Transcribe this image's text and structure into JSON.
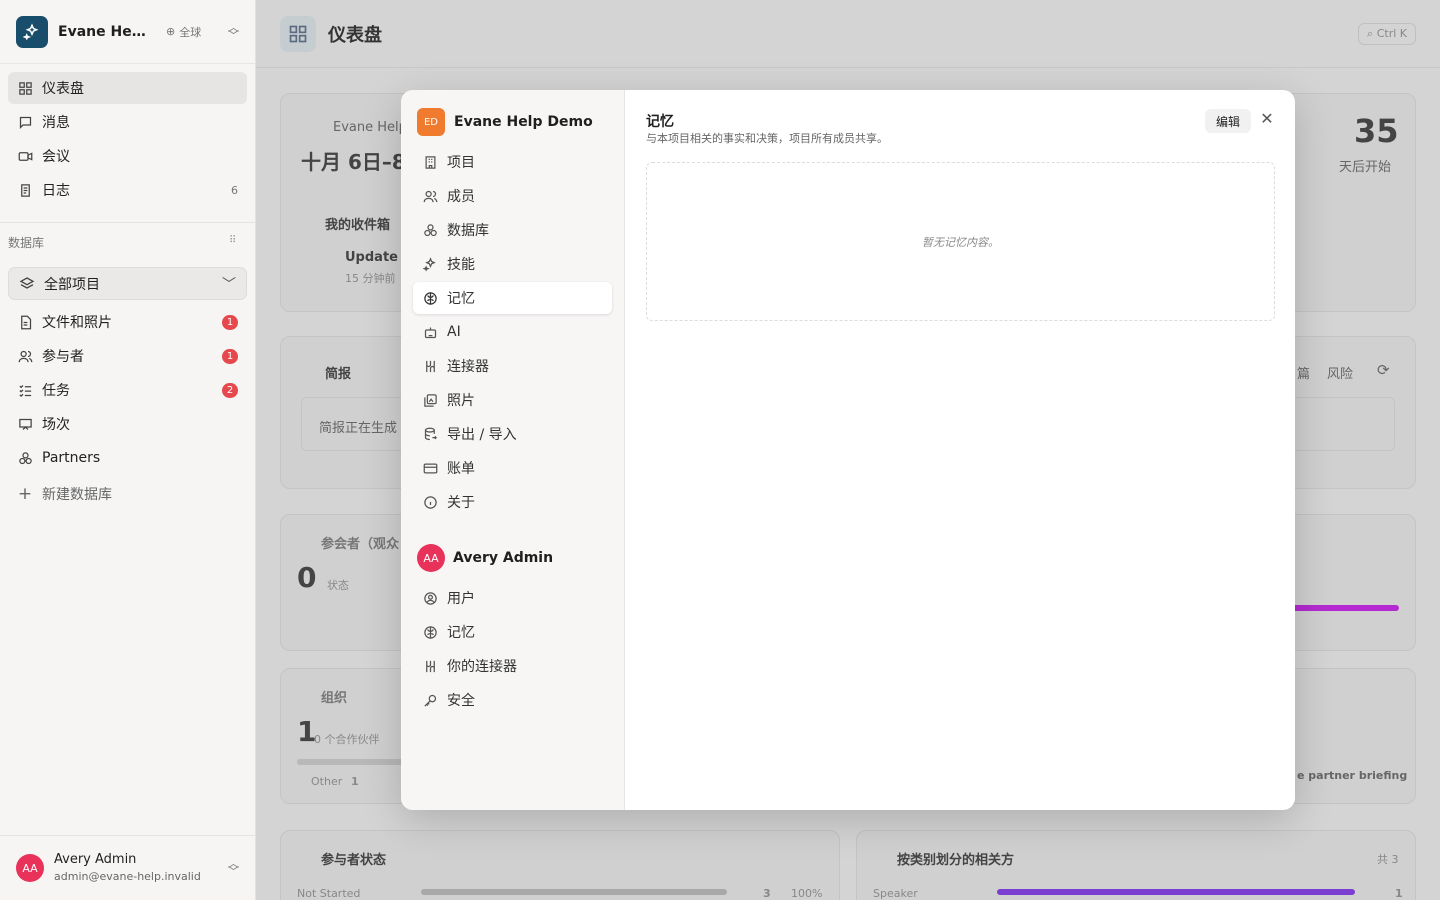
{
  "workspace": {
    "name": "Evane Help Demo",
    "logo": "sparkle-logo",
    "scope": "全球"
  },
  "sidebar": {
    "nav": [
      {
        "label": "仪表盘",
        "icon": "dashboard-icon",
        "active": true
      },
      {
        "label": "消息",
        "icon": "message-icon"
      },
      {
        "label": "会议",
        "icon": "video-icon"
      },
      {
        "label": "日志",
        "icon": "log-icon",
        "count": "6"
      }
    ],
    "section_label": "数据库",
    "project_select": "全部项目",
    "databases": [
      {
        "label": "文件和照片",
        "icon": "file-icon",
        "badge": "1"
      },
      {
        "label": "参与者",
        "icon": "users-icon",
        "badge": "1"
      },
      {
        "label": "任务",
        "icon": "task-icon",
        "badge": "2"
      },
      {
        "label": "场次",
        "icon": "session-icon"
      },
      {
        "label": "Partners",
        "icon": "partners-icon"
      }
    ],
    "new_db": "新建数据库"
  },
  "user": {
    "initials": "AA",
    "name": "Avery Admin",
    "email": "admin@evane-help.invalid"
  },
  "main": {
    "title": "仪表盘",
    "search_hint": "Ctrl K",
    "bg": {
      "date_caption": "Evane Help",
      "date": "十月 6日–8",
      "inbox": "我的收件箱",
      "inbox_item": "Update",
      "inbox_time": "15 分钟前",
      "days": "35",
      "days_caption": "天后开始",
      "brief": "简报",
      "brief_status": "简报正在生成",
      "brief_tab_a": "篇",
      "brief_tab_b": "风险",
      "attendees": "参会者（观众",
      "attendees_num": "0",
      "attendees_sub": "状态",
      "org": "组织",
      "org_num": "1",
      "org_sub": "0 个合作伙伴",
      "org_other": "Other",
      "org_other_n": "1",
      "briefing_btn": "e partner briefing",
      "p_status": "参与者状态",
      "p_row": "Not Started",
      "p_row_n": "3",
      "p_row_pct": "100%",
      "cat": "按类别划分的相关方",
      "cat_total": "共 3",
      "cat_row": "Speaker",
      "cat_row_n": "1"
    }
  },
  "modal": {
    "workspace_initials": "ED",
    "workspace_name": "Evane Help Demo",
    "project_nav": [
      {
        "label": "项目",
        "icon": "building-icon"
      },
      {
        "label": "成员",
        "icon": "members-icon"
      },
      {
        "label": "数据库",
        "icon": "database-icon"
      },
      {
        "label": "技能",
        "icon": "sparkle-icon"
      },
      {
        "label": "记忆",
        "icon": "brain-icon",
        "active": true
      },
      {
        "label": "AI",
        "icon": "robot-icon"
      },
      {
        "label": "连接器",
        "icon": "connector-icon"
      },
      {
        "label": "照片",
        "icon": "photos-icon"
      },
      {
        "label": "导出 / 导入",
        "icon": "export-icon"
      },
      {
        "label": "账单",
        "icon": "card-icon"
      },
      {
        "label": "关于",
        "icon": "info-icon"
      }
    ],
    "user_initials": "AA",
    "user_name": "Avery Admin",
    "user_nav": [
      {
        "label": "用户",
        "icon": "user-circle-icon"
      },
      {
        "label": "记忆",
        "icon": "brain-icon"
      },
      {
        "label": "你的连接器",
        "icon": "connector-icon"
      },
      {
        "label": "安全",
        "icon": "key-icon"
      }
    ],
    "panel": {
      "title": "记忆",
      "description": "与本项目相关的事实和决策，项目所有成员共享。",
      "edit_label": "编辑",
      "empty_text": "暂无记忆内容。"
    }
  }
}
